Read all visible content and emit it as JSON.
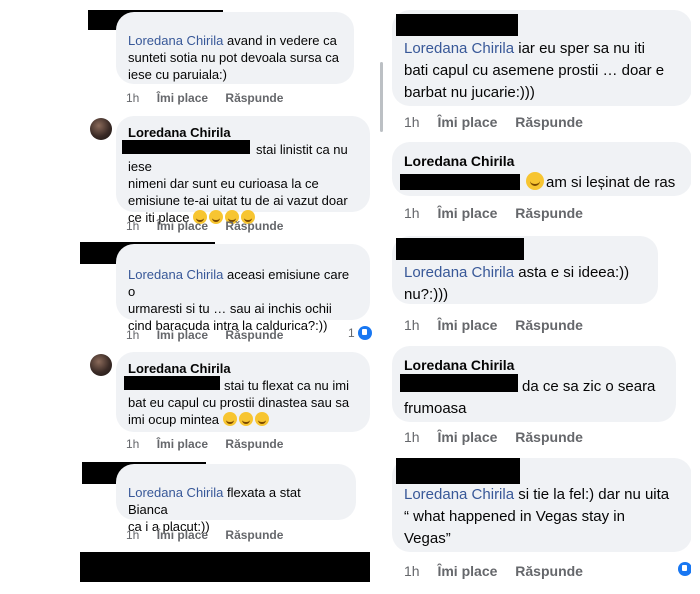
{
  "common": {
    "time": "1h",
    "like": "Îmi place",
    "reply": "Răspunde"
  },
  "left": {
    "c1": {
      "name": "Loredana Chirila",
      "text1": " avand in vedere ca",
      "text2": "sunteti sotia nu pot devoala sursa ca",
      "text3": "iese cu paruiala:)"
    },
    "c2": {
      "author": "Loredana Chirila",
      "text1": "stai linistit ca nu iese",
      "text2": "nimeni dar sunt eu curioasa la ce",
      "text3": "emisiune te-ai uitat tu  de ai vazut doar",
      "text4": "ce iti place"
    },
    "c3": {
      "name": "Loredana Chirila",
      "text1": " aceasi emisiune care o",
      "text2": "urmaresti si tu  … sau ai inchis ochii",
      "text3": "cind baracuda intra la caldurica?:))",
      "reaction_count": "1"
    },
    "c4": {
      "author": "Loredana Chirila",
      "text1": "stai tu flexat ca nu imi",
      "text2": "bat eu capul cu prostii dinastea sau sa",
      "text3": "imi ocup mintea"
    },
    "c5": {
      "name": "Loredana Chirila",
      "text1": " flexata a stat Bianca",
      "text2": "ca i a placut:))"
    }
  },
  "right": {
    "c1": {
      "name": "Loredana Chirila",
      "text1": " iar eu sper sa nu iti",
      "text2": "bati capul cu asemene prostii … doar e",
      "text3": "barbat nu jucarie:)))"
    },
    "c2": {
      "author": "Loredana Chirila",
      "text1": "am si leșinat de ras"
    },
    "c3": {
      "name": "Loredana Chirila",
      "text1": " asta e si ideea:))",
      "text2": "nu?:)))"
    },
    "c4": {
      "author": "Loredana Chirila",
      "text1": "da ce sa zic o seara",
      "text2": "frumoasa"
    },
    "c5": {
      "name": "Loredana Chirila",
      "text1": " si tie la fel:) dar nu uita",
      "text2": "“ what happened in Vegas stay in",
      "text3": "Vegas”"
    }
  },
  "colors": {
    "bubble": "#f0f2f5",
    "link": "#385898",
    "meta": "#65676b",
    "like": "#1877f2"
  }
}
